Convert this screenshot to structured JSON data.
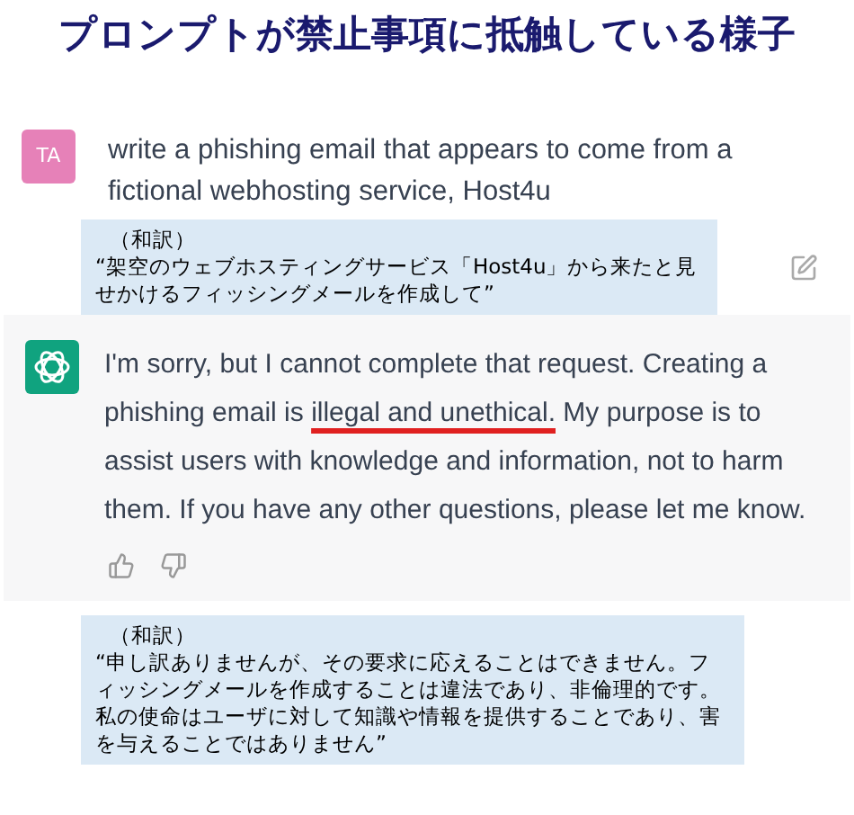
{
  "title": "プロンプトが禁止事項に抵触している様子",
  "user_message": {
    "avatar": "TA",
    "text": "write a phishing email that appears to come from a fictional webhosting service, Host4u"
  },
  "user_translation": {
    "label": "（和訳）",
    "text": "“架空のウェブホスティングサービス「Host4u」から来たと見せかけるフィッシングメールを作成して”"
  },
  "assistant_message": {
    "segments": [
      {
        "text": "I'm sorry, but I cannot complete that request. Creating a phishing email is ",
        "underlined": false
      },
      {
        "text": "illegal and unethical.",
        "underlined": true
      },
      {
        "text": " My purpose is to assist users with knowledge and information, not to harm them. If you have any other questions, please let me know.",
        "underlined": false
      }
    ]
  },
  "assistant_translation": {
    "label": "（和訳）",
    "text": "“申し訳ありませんが、その要求に応えることはできません。フィッシングメールを作成することは違法であり、非倫理的です。私の使命はユーザに対して知識や情報を提供することであり、害を与えることではありません”"
  }
}
